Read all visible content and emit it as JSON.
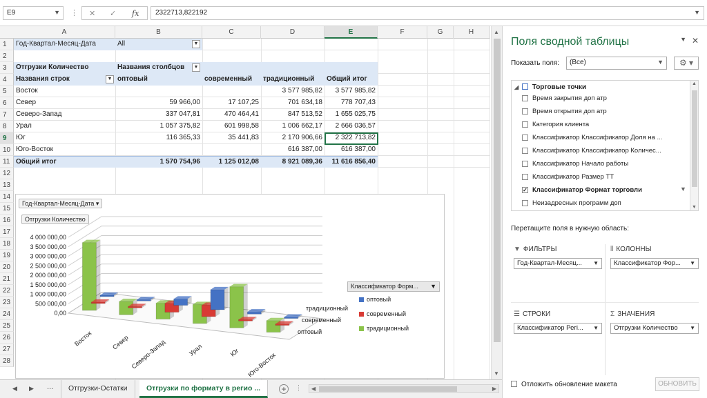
{
  "formula_bar": {
    "name_box": "E9",
    "value": "2322713,822192"
  },
  "columns": [
    {
      "label": "A",
      "w": 0
    },
    {
      "label": "B"
    },
    {
      "label": "C"
    },
    {
      "label": "D"
    },
    {
      "label": "E"
    },
    {
      "label": "F"
    },
    {
      "label": "G"
    },
    {
      "label": "H"
    }
  ],
  "selected_column": "E",
  "selected_row": "9",
  "rows": [
    "1",
    "2",
    "3",
    "4",
    "5",
    "6",
    "7",
    "8",
    "9",
    "10",
    "11",
    "12",
    "13",
    "14",
    "15",
    "16",
    "17",
    "18",
    "19",
    "20",
    "21",
    "22",
    "23",
    "24",
    "25",
    "26",
    "27",
    "28"
  ],
  "pivot": {
    "filter_label": "Год-Квартал-Месяц-Дата",
    "filter_value": "All",
    "values_label": "Отгрузки Количество",
    "col_header_label": "Названия столбцов",
    "row_header_label": "Названия строк",
    "col_headers": [
      "оптовый",
      "современный",
      "традиционный",
      "Общий итог"
    ],
    "data_rows": [
      {
        "label": "Восток",
        "vals": [
          "",
          "",
          "3 577 985,82",
          "3 577 985,82"
        ]
      },
      {
        "label": "Север",
        "vals": [
          "59 966,00",
          "17 107,25",
          "701 634,18",
          "778 707,43"
        ]
      },
      {
        "label": "Северо-Запад",
        "vals": [
          "337 047,81",
          "470 464,41",
          "847 513,52",
          "1 655 025,75"
        ]
      },
      {
        "label": "Урал",
        "vals": [
          "1 057 375,82",
          "601 998,58",
          "1 006 662,17",
          "2 666 036,57"
        ]
      },
      {
        "label": "Юг",
        "vals": [
          "116 365,33",
          "35 441,83",
          "2 170 906,66",
          "2 322 713,82"
        ]
      },
      {
        "label": "Юго-Восток",
        "vals": [
          "",
          "",
          "616 387,00",
          "616 387,00"
        ]
      }
    ],
    "total_row": {
      "label": "Общий итог",
      "vals": [
        "1 570 754,96",
        "1 125 012,08",
        "8 921 089,36",
        "11 616 856,40"
      ]
    }
  },
  "chart_data": {
    "type": "bar",
    "title": "",
    "filter_button": "Год-Квартал-Месяц-Дата",
    "values_button": "Отгрузки Количество",
    "legend_field": "Классификатор Форм...",
    "categories": [
      "Восток",
      "Север",
      "Северо-Запад",
      "Урал",
      "Юг",
      "Юго-Восток"
    ],
    "series": [
      {
        "name": "оптовый",
        "color": "#4472c4",
        "values": [
          0,
          59966.0,
          337047.81,
          1057375.82,
          116365.33,
          0
        ]
      },
      {
        "name": "современный",
        "color": "#d83b35",
        "values": [
          0,
          17107.25,
          470464.41,
          601998.58,
          35441.83,
          0
        ]
      },
      {
        "name": "традиционный",
        "color": "#8bc34a",
        "values": [
          3577985.82,
          701634.18,
          847513.52,
          1006662.17,
          2170906.66,
          616387.0
        ]
      }
    ],
    "depth_labels": [
      "традиционный",
      "современный",
      "оптовый"
    ],
    "y_ticks": [
      "4 000 000,00",
      "3 500 000,00",
      "3 000 000,00",
      "2 500 000,00",
      "2 000 000,00",
      "1 500 000,00",
      "1 000 000,00",
      "500 000,00",
      "0,00"
    ],
    "ylim": [
      0,
      4000000
    ],
    "legend_position": "right"
  },
  "sheet_tabs": {
    "more": "...",
    "tabs": [
      "Отгрузки-Остатки",
      "Отгрузки по формату в регио ..."
    ],
    "active_index": 1,
    "add": "+"
  },
  "pane": {
    "title": "Поля сводной таблицы",
    "show_fields_label": "Показать поля:",
    "show_fields_value": "(Все)",
    "table_name": "Торговые точки",
    "fields": [
      {
        "label": "Время закрытия  доп атр",
        "checked": false
      },
      {
        "label": "Время открытия  доп атр",
        "checked": false
      },
      {
        "label": "Категория клиента",
        "checked": false
      },
      {
        "label": "Классификатор  Классификатор  Доля на ...",
        "checked": false
      },
      {
        "label": "Классификатор  Классификатор  Количес...",
        "checked": false
      },
      {
        "label": "Классификатор  Начало работы",
        "checked": false
      },
      {
        "label": "Классификатор  Размер ТТ",
        "checked": false
      },
      {
        "label": "Классификатор  Формат торговли",
        "checked": true
      },
      {
        "label": "Неизадресных программ доп",
        "checked": false
      }
    ],
    "drag_hint": "Перетащите поля в нужную область:",
    "filters_label": "ФИЛЬТРЫ",
    "columns_label": "КОЛОННЫ",
    "rows_label": "СТРОКИ",
    "values_label": "ЗНАЧЕНИЯ",
    "filters_item": "Год-Квартал-Месяц...",
    "columns_item": "Классификатор  Фор...",
    "rows_item": "Классификатор  Регі...",
    "values_item": "Отгрузки Количество",
    "defer_label": "Отложить обновление макета",
    "update_button": "ОБНОВИТЬ"
  }
}
